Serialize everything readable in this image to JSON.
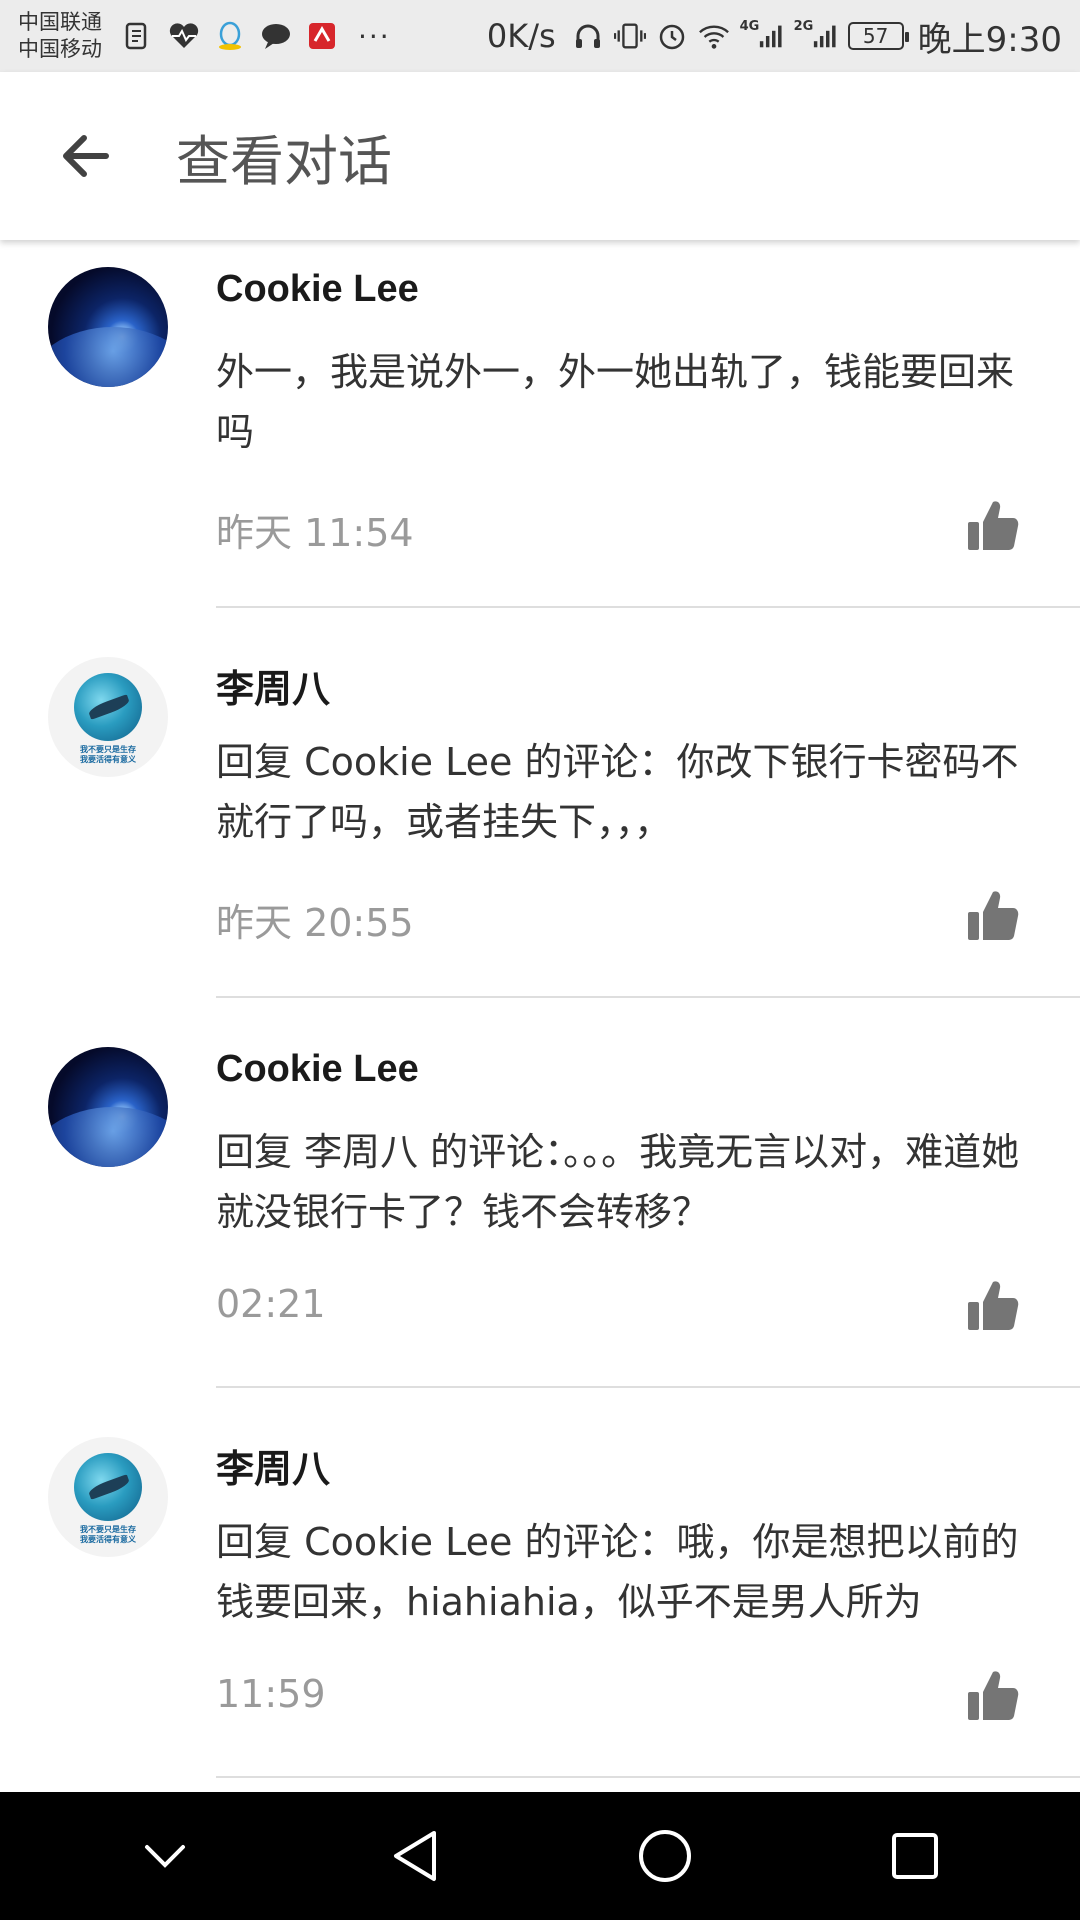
{
  "status_bar": {
    "carrier1": "中国联通",
    "carrier2": "中国移动",
    "more": "···",
    "net_speed": "0K/s",
    "net_4g": "4G",
    "net_2g": "2G",
    "battery": "57",
    "time": "晚上9:30"
  },
  "toolbar": {
    "title": "查看对话"
  },
  "comments": [
    {
      "name": "Cookie Lee",
      "text": "外一，我是说外一，外一她出轨了，钱能要回来吗",
      "time": "昨天 11:54",
      "avatar": "earth"
    },
    {
      "name": "李周八",
      "text": "回复 Cookie Lee 的评论：你改下银行卡密码不就行了吗，或者挂失下，，，",
      "time": "昨天 20:55",
      "avatar": "shark"
    },
    {
      "name": "Cookie Lee",
      "text": "回复 李周八 的评论：。。。我竟无言以对，难道她就没银行卡了？钱不会转移？",
      "time": "02:21",
      "avatar": "earth"
    },
    {
      "name": "李周八",
      "text": "回复 Cookie Lee 的评论：哦，你是想把以前的钱要回来，hiahiahia，似乎不是男人所为",
      "time": "11:59",
      "avatar": "shark"
    }
  ],
  "avatar_caption": {
    "line1": "我不要只是生存",
    "line2": "我要活得有意义"
  },
  "colors": {
    "status_bar_bg": "#ececec",
    "nav_bar_bg": "#000000",
    "time_text": "#9a9a9a",
    "like_icon": "#757575"
  },
  "icons": {
    "back": "arrow-left-icon",
    "like": "thumbs-up-icon",
    "nav_down": "chevron-down-icon",
    "nav_back": "triangle-back-icon",
    "nav_home": "circle-home-icon",
    "nav_recent": "square-recents-icon"
  }
}
